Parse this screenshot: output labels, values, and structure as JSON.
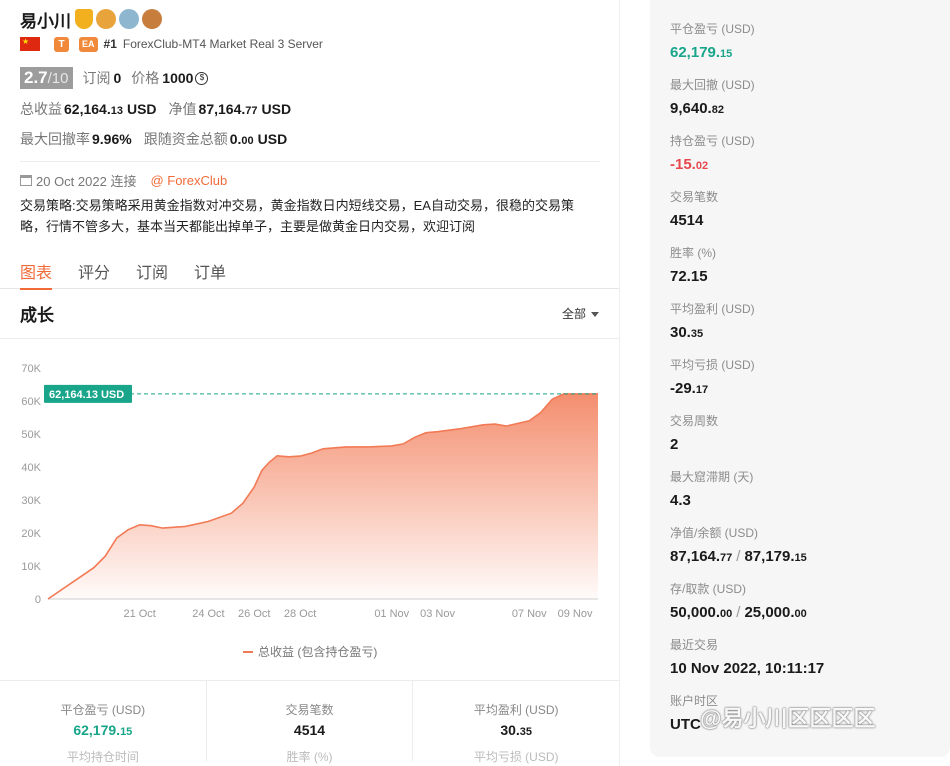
{
  "profile": {
    "name": "易小川",
    "rank": "#1",
    "server": "ForexClub-MT4 Market Real 3 Server",
    "tag_t": "T",
    "tag_ea": "EA",
    "score": "2.7",
    "score_max": "/10",
    "subs_label": "订阅",
    "subs_value": "0",
    "price_label": "价格",
    "price_value": "1000",
    "total_profit_label": "总收益",
    "total_profit_int": "62,164.",
    "total_profit_dec": "13",
    "equity_label": "净值",
    "equity_int": "87,164.",
    "equity_dec": "77",
    "unit": "USD",
    "max_dd_label": "最大回撤率",
    "max_dd_value": "9.96%",
    "follow_label": "跟随资金总额",
    "follow_int": "0.",
    "follow_dec": "00",
    "connected": "20 Oct 2022 连接",
    "broker": "@ ForexClub",
    "strategy": "交易策略:交易策略采用黄金指数对冲交易，黄金指数日内短线交易，EA自动交易，很稳的交易策略，行情不管多大，基本当天都能出掉单子，主要是做黄金日内交易，欢迎订阅"
  },
  "tabs": [
    {
      "label": "图表",
      "active": true
    },
    {
      "label": "评分",
      "active": false
    },
    {
      "label": "订阅",
      "active": false
    },
    {
      "label": "订单",
      "active": false
    }
  ],
  "chart_header": {
    "title": "成长",
    "range": "全部"
  },
  "chart_data": {
    "type": "area",
    "title": "",
    "legend": "总收益 (包含持仓盈亏)",
    "current_label": "62,164.13 USD",
    "current_value": 62164.13,
    "ylim": [
      0,
      70000
    ],
    "yticks": [
      0,
      10000,
      20000,
      30000,
      40000,
      50000,
      60000,
      70000
    ],
    "ytick_labels": [
      "0",
      "10K",
      "20K",
      "30K",
      "40K",
      "50K",
      "60K",
      "70K"
    ],
    "xlim": [
      "2022-10-17",
      "2022-11-10"
    ],
    "xtick_labels": [
      "21 Oct",
      "24 Oct",
      "26 Oct",
      "28 Oct",
      "01 Nov",
      "03 Nov",
      "07 Nov",
      "09 Nov"
    ],
    "color": "#f27a55",
    "x": [
      "17 Oct",
      "19 Oct",
      "19 Oct",
      "20 Oct",
      "20 Oct",
      "21 Oct",
      "21 Oct",
      "22 Oct",
      "23 Oct",
      "24 Oct",
      "25 Oct",
      "25 Oct",
      "26 Oct",
      "26 Oct",
      "26 Oct",
      "27 Oct",
      "27 Oct",
      "28 Oct",
      "28 Oct",
      "29 Oct",
      "30 Oct",
      "31 Oct",
      "01 Nov",
      "01 Nov",
      "02 Nov",
      "02 Nov",
      "03 Nov",
      "04 Nov",
      "05 Nov",
      "05 Nov",
      "06 Nov",
      "07 Nov",
      "07 Nov",
      "08 Nov",
      "08 Nov",
      "09 Nov",
      "10 Nov"
    ],
    "series": [
      {
        "values": [
          0,
          9500,
          13000,
          18500,
          21000,
          22500,
          22200,
          21500,
          22000,
          23500,
          26000,
          29000,
          34000,
          39000,
          41500,
          43400,
          43100,
          43300,
          44200,
          45500,
          46100,
          46100,
          46400,
          47000,
          49000,
          50400,
          50700,
          51600,
          52800,
          53000,
          52400,
          54000,
          56500,
          60500,
          62164,
          62164,
          62164
        ]
      }
    ]
  },
  "bottom_stats": [
    {
      "label": "平仓盈亏 (USD)",
      "int": "62,179.",
      "dec": "15",
      "positive": true,
      "next_label": "平均持仓时间"
    },
    {
      "label": "交易笔数",
      "int": "4514",
      "dec": "",
      "positive": false,
      "next_label": "胜率 (%)"
    },
    {
      "label": "平均盈利 (USD)",
      "int": "30.",
      "dec": "35",
      "positive": false,
      "next_label": "平均亏损 (USD)"
    }
  ],
  "side": [
    {
      "label": "平仓盈亏 (USD)",
      "int": "62,179.",
      "dec": "15",
      "style": "pos"
    },
    {
      "label": "最大回撤 (USD)",
      "int": "9,640.",
      "dec": "82",
      "style": ""
    },
    {
      "label": "持仓盈亏 (USD)",
      "int": "-15.",
      "dec": "02",
      "style": "neg"
    },
    {
      "label": "交易笔数",
      "int": "4514",
      "dec": "",
      "style": ""
    },
    {
      "label": "胜率 (%)",
      "int": "72.15",
      "dec": "",
      "style": ""
    },
    {
      "label": "平均盈利 (USD)",
      "int": "30.",
      "dec": "35",
      "style": ""
    },
    {
      "label": "平均亏损 (USD)",
      "int": "-29.",
      "dec": "17",
      "style": ""
    },
    {
      "label": "交易周数",
      "int": "2",
      "dec": "",
      "style": ""
    },
    {
      "label": "最大窟滞期 (天)",
      "int": "4.3",
      "dec": "",
      "style": ""
    },
    {
      "label": "净值/余额 (USD)",
      "int": "87,164.",
      "dec": "77",
      "int2": "87,179.",
      "dec2": "15",
      "style": ""
    },
    {
      "label": "存/取款 (USD)",
      "int": "50,000.",
      "dec": "00",
      "int2": "25,000.",
      "dec2": "00",
      "style": ""
    },
    {
      "label": "最近交易",
      "int": "10 Nov 2022, 10:11:17",
      "dec": "",
      "style": ""
    },
    {
      "label": "账户时区",
      "int": "UTC",
      "dec": "",
      "style": ""
    }
  ],
  "watermark": "@易小川区区区区"
}
